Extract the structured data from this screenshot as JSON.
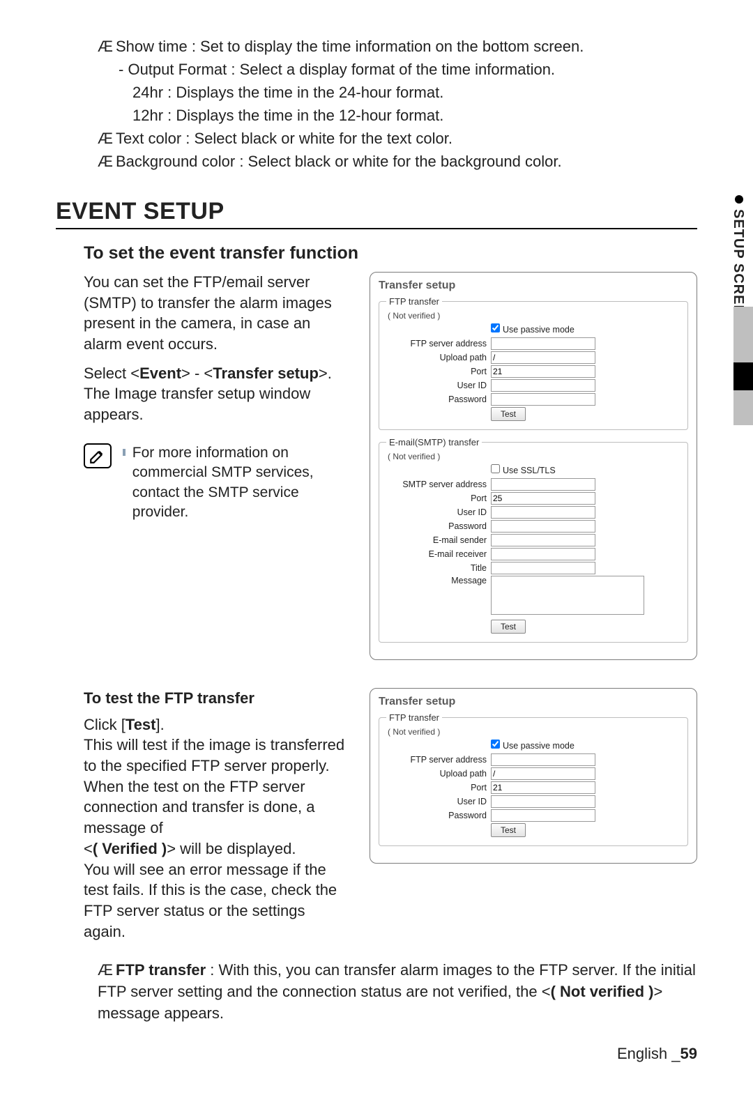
{
  "top": {
    "show_time": "Show time : Set to display the time information on the bottom screen.",
    "output_format": "Output Format : Select a display format of the time information.",
    "fmt24": "24hr : Displays the time in the 24-hour format.",
    "fmt12": "12hr : Displays the time in the 12-hour format.",
    "text_color": "Text color : Select black or white for the text color.",
    "bg_color": "Background color : Select black or white for the background color."
  },
  "heading": "EVENT SETUP",
  "side_tab": "SETUP SCREEN",
  "transfer_section": {
    "heading": "To set the event transfer function",
    "intro": "You can set the FTP/email server (SMTP) to transfer the alarm images present in the camera, in case an alarm event occurs.",
    "select_line_pre": "Select <",
    "select_event": "Event",
    "select_mid": "> - <",
    "select_transfer": "Transfer setup",
    "select_post": ">.",
    "appear": "The Image transfer setup window appears.",
    "note": "For more information on commercial SMTP services, contact the SMTP service provider."
  },
  "panel1": {
    "title": "Transfer setup",
    "ftp": {
      "legend": "FTP transfer",
      "status": "( Not verified )",
      "use_passive": "Use passive mode",
      "addr_label": "FTP server address",
      "addr_val": "",
      "upload_label": "Upload path",
      "upload_val": "/",
      "port_label": "Port",
      "port_val": "21",
      "user_label": "User ID",
      "user_val": "",
      "pass_label": "Password",
      "pass_val": "",
      "test": "Test"
    },
    "smtp": {
      "legend": "E-mail(SMTP) transfer",
      "status": "( Not verified )",
      "use_ssl": "Use SSL/TLS",
      "addr_label": "SMTP server address",
      "addr_val": "",
      "port_label": "Port",
      "port_val": "25",
      "user_label": "User ID",
      "user_val": "",
      "pass_label": "Password",
      "pass_val": "",
      "sender_label": "E-mail sender",
      "sender_val": "",
      "receiver_label": "E-mail receiver",
      "receiver_val": "",
      "title_label": "Title",
      "title_val": "",
      "message_label": "Message",
      "message_val": "",
      "test": "Test"
    }
  },
  "test_section": {
    "heading": "To test the FTP transfer",
    "click_pre": "Click [",
    "click_test": "Test",
    "click_post": "].",
    "l2": "This will test if the image is transferred to the specified FTP server properly.",
    "l3": "When the test on the FTP server connection and transfer is done, a message of",
    "l4_pre": "<",
    "l4_bold": "( Verified )",
    "l4_post": "> will be displayed.",
    "l5": "You will see an error message if the test fails. If this is the case, check the FTP server status or the settings again."
  },
  "panel2": {
    "title": "Transfer setup",
    "ftp": {
      "legend": "FTP transfer",
      "status": "( Not verified )",
      "use_passive": "Use passive mode",
      "addr_label": "FTP server address",
      "addr_val": "",
      "upload_label": "Upload path",
      "upload_val": "/",
      "port_label": "Port",
      "port_val": "21",
      "user_label": "User ID",
      "user_val": "",
      "pass_label": "Password",
      "pass_val": "",
      "test": "Test"
    }
  },
  "ftp_desc": {
    "label": "FTP transfer",
    "text_1": " : With this, you can transfer alarm images to the FTP server. If the initial FTP server setting and the connection status are not verified, the <",
    "bold": "( Not verified )",
    "text_2": "> message appears."
  },
  "footer": {
    "lang": "English _",
    "page": "59"
  },
  "glyph": {
    "ae": "Æ",
    "dash": "- "
  }
}
